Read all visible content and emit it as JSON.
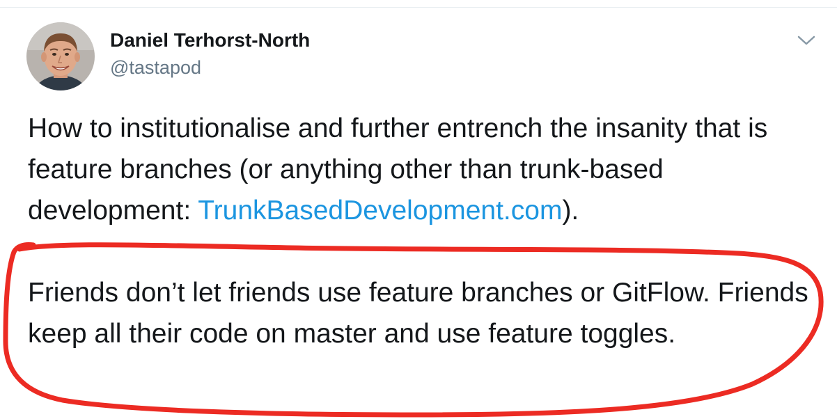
{
  "tweet": {
    "author": {
      "display_name": "Daniel Terhorst-North",
      "handle": "@tastapod"
    },
    "paragraph1": {
      "text_before_link": "How to institutionalise and further entrench the insanity that is feature branches (or anything other than trunk-based development: ",
      "link_text": "TrunkBasedDevelopment.com",
      "text_after_link": ")."
    },
    "paragraph2": {
      "text": "Friends don’t let friends use feature branches or GitFlow. Friends keep all their code on master and use feature toggles."
    },
    "menu_icon": "chevron-down-icon"
  },
  "colors": {
    "link": "#1b95e0",
    "annotation_circle": "#ec2b23",
    "text": "#14171a",
    "secondary_text": "#657786"
  }
}
